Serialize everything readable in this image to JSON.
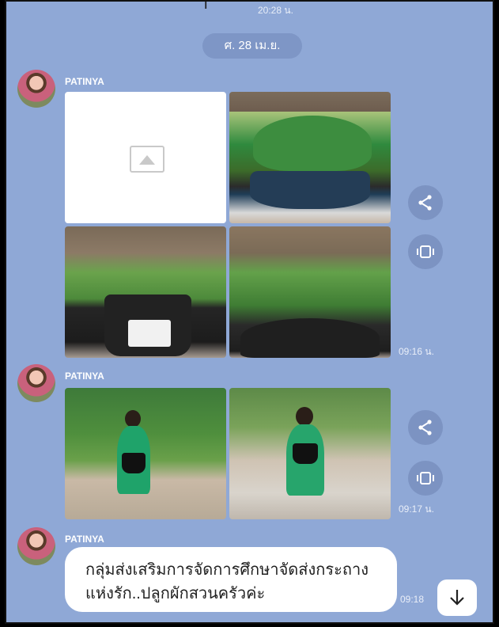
{
  "top": {
    "cut_text": "ſ",
    "time": "20:28 น."
  },
  "date_separator": "ศ. 28 เม.ย.",
  "messages": [
    {
      "sender": "PATINYA",
      "time": "09:16 น."
    },
    {
      "sender": "PATINYA",
      "time": "09:17 น."
    },
    {
      "sender": "PATINYA",
      "time": "09:18",
      "text": "กลุ่มส่งเสริมการจัดการศึกษาจัดส่งกระถางแห่งรัก..ปลูกผักสวนครัวค่ะ"
    }
  ],
  "icons": {
    "share": "share-icon",
    "view": "view-icon",
    "scroll": "arrow-down-icon"
  },
  "colors": {
    "background": "#8fa8d6",
    "pill": "#7e96c6",
    "side_button": "#7c93c2"
  }
}
